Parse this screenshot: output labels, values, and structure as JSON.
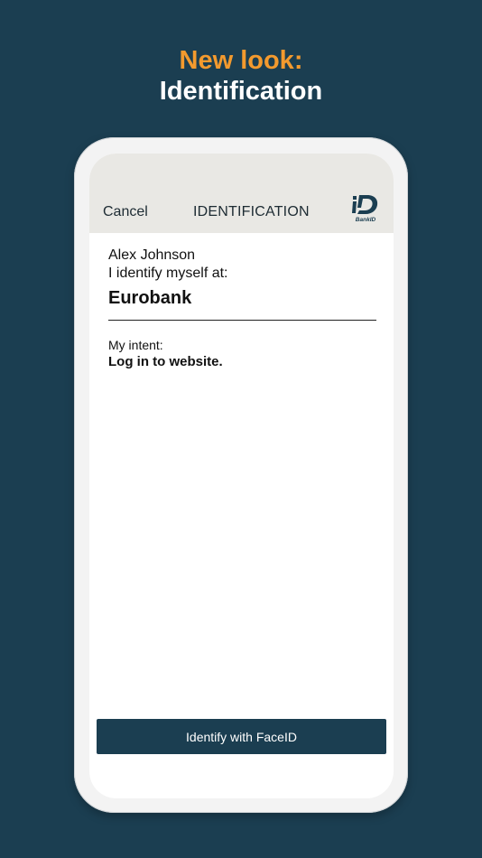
{
  "promo": {
    "line1": "New look:",
    "line2": "Identification"
  },
  "nav": {
    "cancel_label": "Cancel",
    "title": "IDENTIFICATION",
    "logo_text": "BankID"
  },
  "identification": {
    "user_name": "Alex Johnson",
    "identify_at_label": "I identify myself at:",
    "organization": "Eurobank",
    "intent_label": "My intent:",
    "intent_value": "Log in to website."
  },
  "actions": {
    "identify_button_label": "Identify with FaceID"
  },
  "colors": {
    "background": "#1b3e51",
    "accent": "#f39a2e",
    "nav_bar": "#e9e8e4",
    "button": "#1b3e51"
  }
}
